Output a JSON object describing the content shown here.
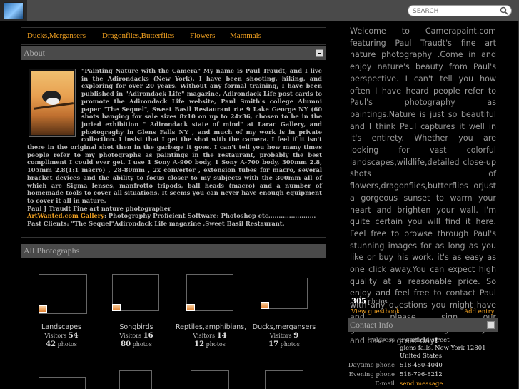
{
  "header": {
    "search_placeholder": "SEARCH"
  },
  "tabs": [
    "Ducks,Mergansers",
    "Dragonflies,Butterflies",
    "Flowers",
    "Mammals"
  ],
  "about": {
    "title": "About",
    "text": "\"Painting Nature with the Camera\" My name is Paul Traudt, and I live in the Adirondacks (New York). I have been shooting, hiking, and exploring for over 20 years. Without any formal training, I have been published in \"Adirondack Life\" magazine, Adirondack Life post cards to promote the Adirondack Life website, Paul Smith's college Alumni paper \"The Sequel\", Sweet Basil Restaurant rte 9 Lake George NY (60 shots hanging for sale sizes 8x10 on up to 24x36, chosen to be in the juried exhibition \" Adirondack state of mind\" at Larac Gallery, and photograghy in Glens Falls NY , and much of my work is in private collection. I insist that I get the shot with the camera. I feel if it isn't there in the original shot then in the garbage it goes. I can't tell you how many times people refer to my photographs as paintings in the restaurant, probably the best compliment I could ever get. I use 1 Sony A-900 body, 1 Sony A-700 body, 300mm 2.8, 105mm 2.8(1:1 macro) , 28-80mm , 2x converter , extension tubes for macro, several bracket devices and the ability to focus closer to my subjects with the 300mm all of which are Sigma lenses, manfrotto tripods, ball heads (macro) and a number of homemade tools to cover all situations. It seems you can never have enough equipment to cover it all in nature.",
    "signature": "Paul J Traudt Fine art nature photographer",
    "gallery_link": "ArtWanted.com Gallery",
    "gallery_rest": ": Photography Proficient Software: Photoshop etc.......................",
    "clients": "Past Clients: \"The Sequel\"Adirondack Life magazine ,Sweet Basil Restaurant."
  },
  "photos_section": {
    "title": "All Photographs",
    "visitors_label": "Visitors",
    "photos_label": "photos",
    "albums": [
      {
        "name": "Landscapes",
        "visitors": "54",
        "photos": "42"
      },
      {
        "name": "Songbirds",
        "visitors": "16",
        "photos": "80"
      },
      {
        "name": "Reptiles,amphibians,",
        "visitors": "14",
        "photos": "12"
      },
      {
        "name": "Ducks,mergansers",
        "visitors": "9",
        "photos": "17"
      }
    ]
  },
  "welcome": {
    "text": "Welcome to Camerapaint.com featuring Paul Traudt's fine art nature photography .Come in and enjoy nature's beauty from Paul's perspective. I can't tell you how often I have heard people refer to Paul's photography as paintings.Nature is just so beautiful and I think Paul captures it well in it's entirety. Whether you are looking for vast colorful landscapes,wildlife,detailed close-up shots of flowers,dragonflies,butterflies orjust a gorgeous sunset to warm your heart and brighten your wall. I'm quite certain you will find it here. Feel free to browse through Paul's stunning images for as long as you like or buy his work. it's as easy as one click away.You can expect high quality at a reasonable price. So enjoy and feel free to contact Paul with any questions you might have and please sign our guestbookbefore leaving. Thank you and have a great day",
    "end": "!"
  },
  "guestbook": {
    "count": "305",
    "count_label": "photos",
    "view": "View guestbook",
    "add": "Add entry"
  },
  "contact": {
    "title": "Contact Info",
    "address_label": "Address",
    "address_1": "3 garfield street",
    "address_2": "glens falls, New York 12801",
    "address_3": "United States",
    "day_label": "Daytime phone",
    "day_value": "518-480-4040",
    "eve_label": "Evening phone",
    "eve_value": "518-796-8212",
    "email_label": "E-mail",
    "email_value": "send message"
  },
  "colors": {
    "accent": "#f0a020",
    "header_bg": "#4a4a4a",
    "page_bg": "#000000"
  }
}
